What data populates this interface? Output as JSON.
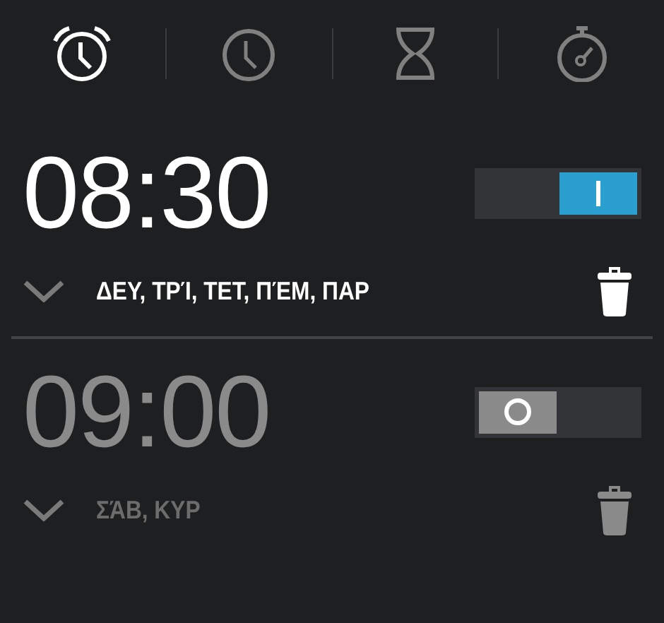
{
  "tabs": [
    {
      "kind": "alarm",
      "selected": true
    },
    {
      "kind": "clock",
      "selected": false
    },
    {
      "kind": "timer",
      "selected": false
    },
    {
      "kind": "stopwatch",
      "selected": false
    }
  ],
  "alarms": [
    {
      "time": "08:30",
      "on": true,
      "days": "ΔΕΥ, ΤΡΊ, ΤΕΤ, ΠΈΜ, ΠΑΡ"
    },
    {
      "time": "09:00",
      "on": false,
      "days": "ΣΆΒ, ΚΥΡ"
    }
  ]
}
